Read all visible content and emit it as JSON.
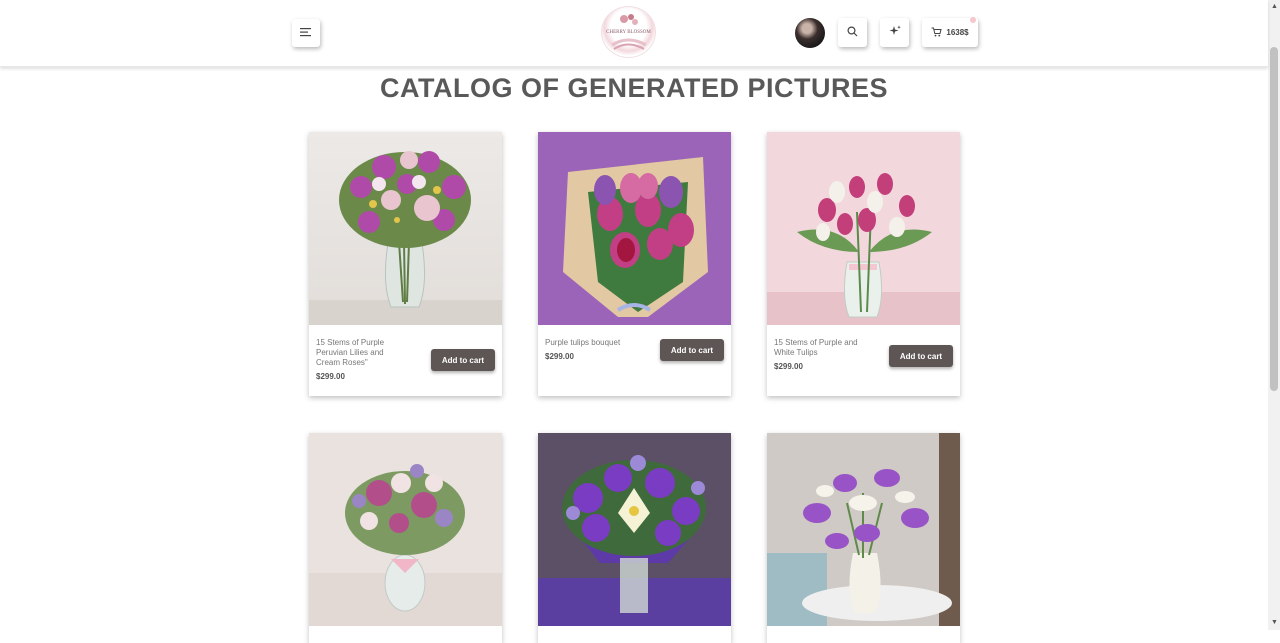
{
  "header": {
    "logo_text": "CHERRY BLOSSOM",
    "cart_total": "1638$"
  },
  "page": {
    "title": "CATALOG OF GENERATED PICTURES"
  },
  "products": [
    {
      "name": "15 Stems of Purple Peruvian Lilies and Cream Roses\"",
      "price": "$299.00",
      "button": "Add to cart"
    },
    {
      "name": "Purple tulips bouquet",
      "price": "$299.00",
      "button": "Add to cart"
    },
    {
      "name": "15 Stems of Purple and White Tulips",
      "price": "$299.00",
      "button": "Add to cart"
    },
    {
      "name": "",
      "price": "",
      "button": ""
    },
    {
      "name": "",
      "price": "",
      "button": ""
    },
    {
      "name": "",
      "price": "",
      "button": ""
    }
  ],
  "icons": {
    "menu": "menu-icon",
    "search": "search-icon",
    "magic": "sparkle-icon",
    "cart": "cart-icon"
  },
  "colors": {
    "button_bg": "#5e5655",
    "title": "#595959",
    "accent_pink": "#f6c7cc"
  }
}
